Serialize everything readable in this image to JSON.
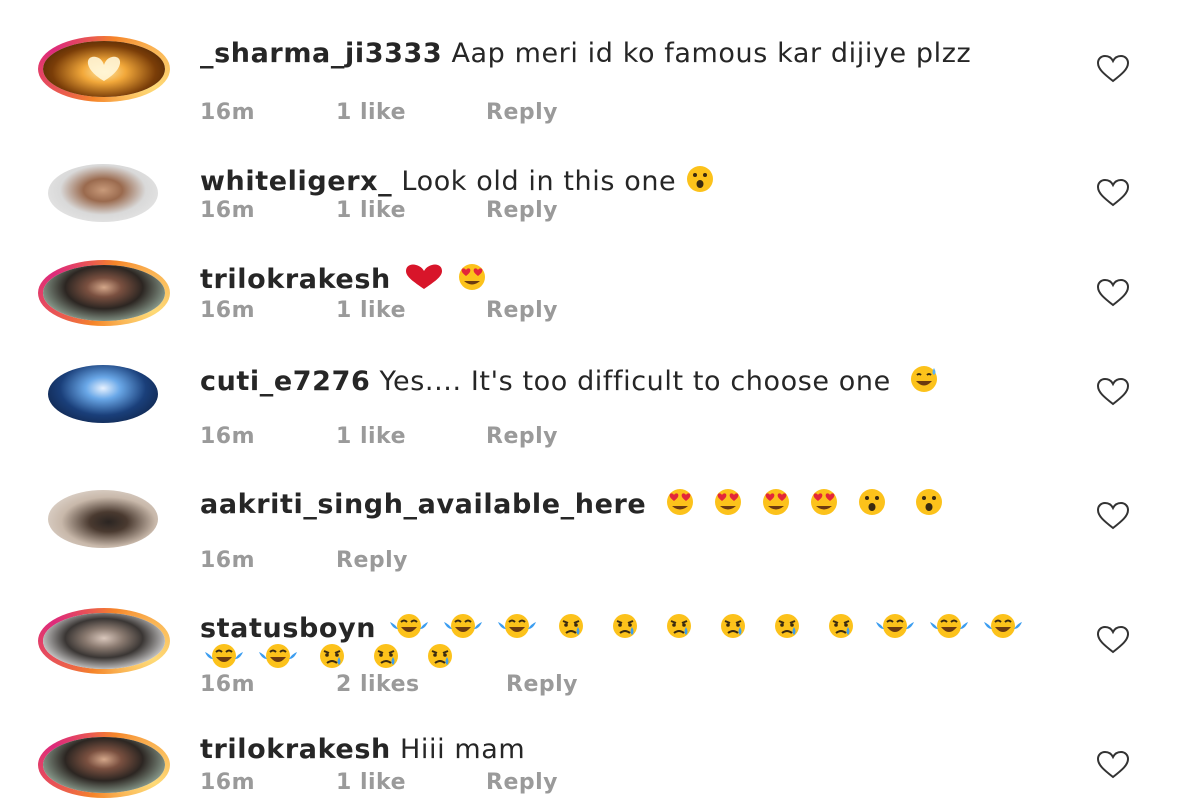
{
  "comments": [
    {
      "username": "_sharma_ji3333",
      "text": "Aap meri id ko famous kar dijiye plzz",
      "time": "16m",
      "likes": "1 like",
      "reply": "Reply",
      "emojis": [],
      "avatar": "heart-hands-photo",
      "story_ring": true
    },
    {
      "username": "whiteligerx_",
      "text": "Look old in this one",
      "time": "16m",
      "likes": "1 like",
      "reply": "Reply",
      "emojis": [
        "surprised"
      ],
      "avatar": "man-photo",
      "story_ring": false
    },
    {
      "username": "trilokrakesh",
      "text": "",
      "time": "16m",
      "likes": "1 like",
      "reply": "Reply",
      "emojis": [
        "red-heart",
        "heart-eyes"
      ],
      "avatar": "man-photo",
      "story_ring": true
    },
    {
      "username": "cuti_e7276",
      "text": "Yes.... It's too difficult to choose one",
      "time": "16m",
      "likes": "1 like",
      "reply": "Reply",
      "emojis": [
        "sweat-smile"
      ],
      "avatar": "blue-art-photo",
      "story_ring": false
    },
    {
      "username": "aakriti_singh_available_here",
      "text": "",
      "time": "16m",
      "likes": "",
      "reply": "Reply",
      "emojis": [
        "heart-eyes",
        "heart-eyes",
        "heart-eyes",
        "heart-eyes",
        "surprised",
        "surprised"
      ],
      "avatar": "woman-photo",
      "story_ring": false
    },
    {
      "username": "statusboyn",
      "text": "",
      "time": "16m",
      "likes": "2 likes",
      "reply": "Reply",
      "emojis": [
        "tears-of-joy",
        "tears-of-joy",
        "tears-of-joy",
        "crying",
        "crying",
        "crying",
        "crying",
        "crying",
        "crying",
        "tears-of-joy",
        "tears-of-joy",
        "tears-of-joy",
        "tears-of-joy",
        "tears-of-joy",
        "crying",
        "crying",
        "crying"
      ],
      "avatar": "man-photo",
      "story_ring": true
    },
    {
      "username": "trilokrakesh",
      "text": "Hiii mam",
      "time": "16m",
      "likes": "1 like",
      "reply": "Reply",
      "emojis": [],
      "avatar": "man-photo",
      "story_ring": true
    }
  ],
  "icons": {
    "like": "heart-outline-icon"
  },
  "colors": {
    "text": "#262626",
    "meta": "#9a9a9a",
    "story_ring_start": "#f58529",
    "story_ring_end": "#dd2a7b"
  }
}
